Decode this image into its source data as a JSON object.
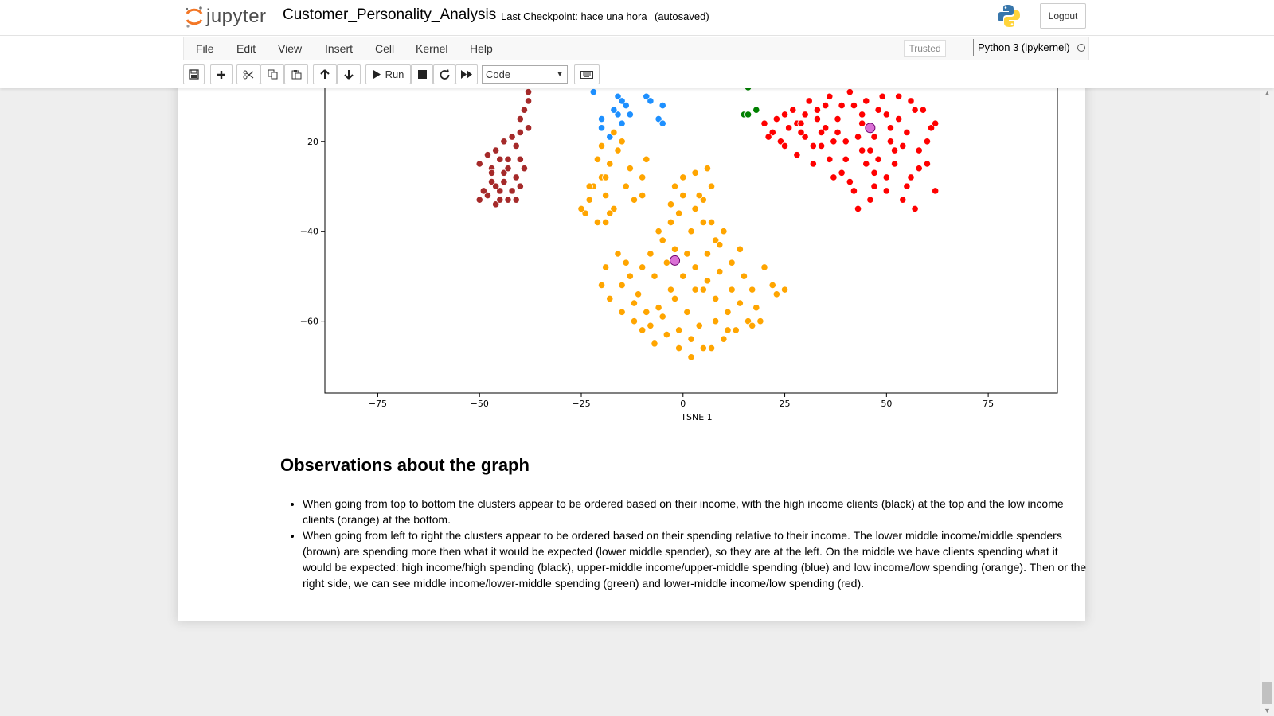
{
  "header": {
    "logo_text": "jupyter",
    "notebook_name": "Customer_Personality_Analysis",
    "checkpoint": "Last Checkpoint: hace una hora",
    "autosave": "(autosaved)",
    "logout_label": "Logout"
  },
  "menu": {
    "items": [
      "File",
      "Edit",
      "View",
      "Insert",
      "Cell",
      "Kernel",
      "Help"
    ],
    "trusted_label": "Trusted",
    "kernel_name": "Python 3 (ipykernel)"
  },
  "toolbar": {
    "run_label": "Run",
    "cell_type": "Code",
    "icons": [
      "save-icon",
      "plus-icon",
      "scissors-icon",
      "copy-icon",
      "paste-icon",
      "arrow-up-icon",
      "arrow-down-icon",
      "play-icon",
      "stop-icon",
      "restart-icon",
      "fast-forward-icon",
      "keyboard-icon"
    ]
  },
  "chart_data": {
    "type": "scatter",
    "xlabel": "TSNE 1",
    "xlim": [
      -88,
      92
    ],
    "ylim": [
      -76,
      -8
    ],
    "x_ticks": [
      -75,
      -50,
      -25,
      0,
      25,
      50,
      75
    ],
    "y_ticks": [
      -20,
      -40,
      -60
    ],
    "series": [
      {
        "color": "#a52a2a",
        "values": [
          [
            -38,
            -9
          ],
          [
            -38,
            -11
          ],
          [
            -39,
            -13
          ],
          [
            -40,
            -15
          ],
          [
            -38,
            -17
          ],
          [
            -40,
            -18
          ],
          [
            -42,
            -19
          ],
          [
            -41,
            -21
          ],
          [
            -44,
            -20
          ],
          [
            -46,
            -22
          ],
          [
            -45,
            -24
          ],
          [
            -48,
            -23
          ],
          [
            -50,
            -25
          ],
          [
            -47,
            -26
          ],
          [
            -43,
            -24
          ],
          [
            -40,
            -24
          ],
          [
            -44,
            -27
          ],
          [
            -47,
            -29
          ],
          [
            -41,
            -28
          ],
          [
            -40,
            -30
          ],
          [
            -45,
            -31
          ],
          [
            -48,
            -32
          ],
          [
            -43,
            -33
          ],
          [
            -41,
            -33
          ],
          [
            -46,
            -34
          ],
          [
            -49,
            -31
          ],
          [
            -44,
            -29
          ],
          [
            -47,
            -27
          ],
          [
            -45,
            -33
          ],
          [
            -42,
            -31
          ],
          [
            -50,
            -33
          ],
          [
            -46,
            -30
          ],
          [
            -43,
            -26
          ],
          [
            -39,
            -26
          ]
        ]
      },
      {
        "color": "#1e90ff",
        "values": [
          [
            -22,
            -9
          ],
          [
            -16,
            -10
          ],
          [
            -15,
            -11
          ],
          [
            -14,
            -12
          ],
          [
            -16,
            -14
          ],
          [
            -15,
            -16
          ],
          [
            -13,
            -14
          ],
          [
            -20,
            -17
          ],
          [
            -18,
            -19
          ],
          [
            -9,
            -10
          ],
          [
            -8,
            -11
          ],
          [
            -5,
            -12
          ],
          [
            -6,
            -15
          ],
          [
            -5,
            -16
          ],
          [
            -20,
            -15
          ],
          [
            -17,
            -13
          ]
        ]
      },
      {
        "color": "#008000",
        "values": [
          [
            16,
            -8
          ],
          [
            15,
            -14
          ],
          [
            18,
            -13
          ],
          [
            16,
            -14
          ]
        ]
      },
      {
        "color": "#ff0000",
        "values": [
          [
            20,
            -16
          ],
          [
            22,
            -18
          ],
          [
            25,
            -14
          ],
          [
            28,
            -16
          ],
          [
            30,
            -19
          ],
          [
            33,
            -13
          ],
          [
            35,
            -17
          ],
          [
            38,
            -15
          ],
          [
            40,
            -20
          ],
          [
            42,
            -12
          ],
          [
            44,
            -16
          ],
          [
            47,
            -19
          ],
          [
            50,
            -14
          ],
          [
            52,
            -22
          ],
          [
            55,
            -18
          ],
          [
            57,
            -13
          ],
          [
            60,
            -20
          ],
          [
            61,
            -17
          ],
          [
            58,
            -26
          ],
          [
            55,
            -30
          ],
          [
            50,
            -28
          ],
          [
            46,
            -33
          ],
          [
            42,
            -31
          ],
          [
            39,
            -27
          ],
          [
            36,
            -24
          ],
          [
            32,
            -21
          ],
          [
            28,
            -23
          ],
          [
            24,
            -20
          ],
          [
            27,
            -13
          ],
          [
            31,
            -11
          ],
          [
            36,
            -10
          ],
          [
            41,
            -9
          ],
          [
            45,
            -11
          ],
          [
            49,
            -10
          ],
          [
            53,
            -10
          ],
          [
            56,
            -11
          ],
          [
            59,
            -13
          ],
          [
            62,
            -16
          ],
          [
            60,
            -25
          ],
          [
            62,
            -31
          ],
          [
            57,
            -35
          ],
          [
            54,
            -33
          ],
          [
            48,
            -24
          ],
          [
            44,
            -22
          ],
          [
            40,
            -24
          ],
          [
            37,
            -20
          ],
          [
            34,
            -21
          ],
          [
            29,
            -18
          ],
          [
            26,
            -17
          ],
          [
            23,
            -15
          ],
          [
            21,
            -19
          ],
          [
            33,
            -15
          ],
          [
            38,
            -18
          ],
          [
            43,
            -19
          ],
          [
            51,
            -17
          ],
          [
            54,
            -21
          ],
          [
            58,
            -22
          ],
          [
            47,
            -27
          ],
          [
            41,
            -29
          ],
          [
            45,
            -25
          ],
          [
            50,
            -31
          ],
          [
            56,
            -28
          ],
          [
            52,
            -25
          ],
          [
            35,
            -12
          ],
          [
            39,
            -12
          ],
          [
            48,
            -13
          ],
          [
            44,
            -14
          ],
          [
            53,
            -15
          ],
          [
            30,
            -14
          ],
          [
            25,
            -21
          ],
          [
            32,
            -25
          ],
          [
            37,
            -28
          ],
          [
            43,
            -35
          ],
          [
            47,
            -30
          ],
          [
            51,
            -20
          ],
          [
            46,
            -22
          ],
          [
            29,
            -16
          ],
          [
            34,
            -18
          ]
        ]
      },
      {
        "color": "#ffa500",
        "values": [
          [
            -22,
            -30
          ],
          [
            -20,
            -28
          ],
          [
            -18,
            -25
          ],
          [
            -16,
            -22
          ],
          [
            -15,
            -20
          ],
          [
            -19,
            -32
          ],
          [
            -24,
            -36
          ],
          [
            -21,
            -38
          ],
          [
            -17,
            -35
          ],
          [
            -12,
            -33
          ],
          [
            -10,
            -32
          ],
          [
            -13,
            -26
          ],
          [
            -20,
            -21
          ],
          [
            -23,
            -30
          ],
          [
            -25,
            -35
          ],
          [
            -19,
            -38
          ],
          [
            -14,
            -30
          ],
          [
            -17,
            -18
          ],
          [
            -10,
            -28
          ],
          [
            -9,
            -24
          ],
          [
            -2,
            -30
          ],
          [
            0,
            -28
          ],
          [
            3,
            -27
          ],
          [
            5,
            -33
          ],
          [
            7,
            -30
          ],
          [
            -3,
            -38
          ],
          [
            -1,
            -36
          ],
          [
            2,
            -40
          ],
          [
            5,
            -38
          ],
          [
            8,
            -42
          ],
          [
            -5,
            -42
          ],
          [
            -8,
            -45
          ],
          [
            -10,
            -48
          ],
          [
            -13,
            -50
          ],
          [
            -15,
            -52
          ],
          [
            -18,
            -55
          ],
          [
            -15,
            -58
          ],
          [
            -12,
            -60
          ],
          [
            -10,
            -62
          ],
          [
            -7,
            -65
          ],
          [
            -4,
            -63
          ],
          [
            -1,
            -66
          ],
          [
            2,
            -68
          ],
          [
            -6,
            -57
          ],
          [
            -3,
            -53
          ],
          [
            0,
            -50
          ],
          [
            3,
            -48
          ],
          [
            6,
            -45
          ],
          [
            9,
            -43
          ],
          [
            12,
            -47
          ],
          [
            15,
            -50
          ],
          [
            17,
            -53
          ],
          [
            18,
            -57
          ],
          [
            16,
            -60
          ],
          [
            13,
            -62
          ],
          [
            10,
            -64
          ],
          [
            7,
            -66
          ],
          [
            4,
            -61
          ],
          [
            1,
            -58
          ],
          [
            -2,
            -55
          ],
          [
            5,
            -53
          ],
          [
            8,
            -55
          ],
          [
            11,
            -58
          ],
          [
            14,
            -56
          ],
          [
            17,
            -61
          ],
          [
            19,
            -60
          ],
          [
            20,
            -48
          ],
          [
            22,
            -52
          ],
          [
            25,
            -53
          ],
          [
            23,
            -54
          ],
          [
            -7,
            -50
          ],
          [
            -4,
            -47
          ],
          [
            -11,
            -54
          ],
          [
            -9,
            -58
          ],
          [
            -14,
            -47
          ],
          [
            -16,
            -45
          ],
          [
            -19,
            -48
          ],
          [
            -20,
            -52
          ],
          [
            -6,
            -40
          ],
          [
            -2,
            -44
          ],
          [
            1,
            -45
          ],
          [
            3,
            -53
          ],
          [
            6,
            -51
          ],
          [
            9,
            -49
          ],
          [
            12,
            -53
          ],
          [
            14,
            -44
          ],
          [
            10,
            -40
          ],
          [
            7,
            -38
          ],
          [
            -1,
            -62
          ],
          [
            2,
            -64
          ],
          [
            5,
            -66
          ],
          [
            8,
            -60
          ],
          [
            11,
            -62
          ],
          [
            -8,
            -61
          ],
          [
            -5,
            -59
          ],
          [
            -12,
            -56
          ],
          [
            0,
            -32
          ],
          [
            3,
            -35
          ],
          [
            -3,
            -34
          ],
          [
            6,
            -26
          ],
          [
            4,
            -32
          ],
          [
            -23,
            -33
          ],
          [
            -19,
            -28
          ],
          [
            -21,
            -24
          ],
          [
            -18,
            -36
          ]
        ]
      },
      {
        "color": "#da70d6",
        "values": [
          [
            -2,
            -46.5
          ],
          [
            46,
            -17
          ]
        ]
      }
    ]
  },
  "markdown": {
    "heading": "Observations about the graph",
    "bullets": [
      "When going from top to bottom the clusters appear to be ordered based on their income, with the high income clients (black) at the top and the low income clients (orange) at the bottom.",
      "When going from left to right the clusters appear to be ordered based on their spending relative to their income. The lower middle income/middle spenders (brown) are spending more then what it would be expected (lower middle spender), so they are at the left. On the middle we have clients spending what it would be expected: high income/high spending (black), upper-middle income/upper-middle spending (blue) and low income/low spending (orange). Then or the right side, we can see middle income/lower-middle spending (green) and lower-middle income/low spending (red)."
    ]
  }
}
